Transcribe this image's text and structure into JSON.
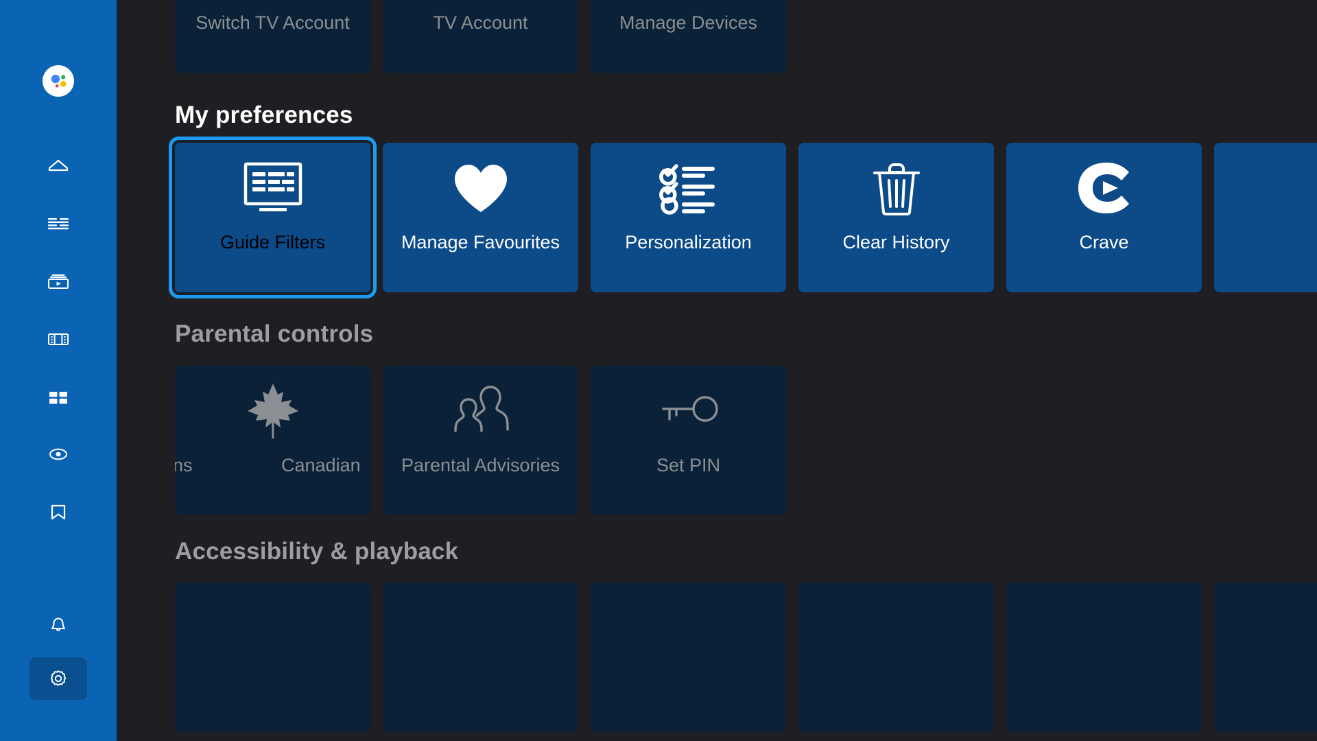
{
  "app": {
    "background_color": "#1f1f23",
    "sidebar_color": "#0b63b3",
    "card_inactive_color": "#0a2137",
    "card_accent_color": "#0c4a88",
    "focus_ring_color": "#1e9bf0"
  },
  "sidebar": {
    "assistant": {
      "name": "google-assistant-icon"
    },
    "items": [
      {
        "name": "home-icon",
        "label": "Home"
      },
      {
        "name": "guide-icon",
        "label": "Guide"
      },
      {
        "name": "on-demand-icon",
        "label": "On Demand"
      },
      {
        "name": "movies-icon",
        "label": "Movies"
      },
      {
        "name": "apps-icon",
        "label": "Apps"
      },
      {
        "name": "recordings-icon",
        "label": "Recordings"
      },
      {
        "name": "bookmarks-icon",
        "label": "Saved"
      }
    ],
    "bottom_items": [
      {
        "name": "notifications-bell-icon",
        "label": "Notifications",
        "active": false
      },
      {
        "name": "settings-gear-icon",
        "label": "Settings",
        "active": true
      }
    ]
  },
  "sections": [
    {
      "id": "account",
      "heading": "",
      "cards": [
        {
          "label": "Switch TV Account",
          "icon": "account-switch-icon",
          "state": "inactive"
        },
        {
          "label": "TV Account",
          "icon": "tv-account-icon",
          "state": "inactive"
        },
        {
          "label": "Manage Devices",
          "icon": "manage-devices-icon",
          "state": "inactive"
        }
      ]
    },
    {
      "id": "my-preferences",
      "heading": "My preferences",
      "cards": [
        {
          "label": "Guide Filters",
          "icon": "guide-filters-icon",
          "state": "focused"
        },
        {
          "label": "Manage Favourites",
          "icon": "heart-icon",
          "state": "accent"
        },
        {
          "label": "Personalization",
          "icon": "checklist-icon",
          "state": "accent"
        },
        {
          "label": "Clear History",
          "icon": "trash-icon",
          "state": "accent"
        },
        {
          "label": "Crave",
          "icon": "crave-logo-icon",
          "state": "accent"
        },
        {
          "label": "",
          "icon": "",
          "state": "accent"
        }
      ]
    },
    {
      "id": "parental-controls",
      "heading": "Parental controls",
      "cards": [
        {
          "label": "Canadian",
          "label_secondary": "cations",
          "icon": "maple-leaf-icon",
          "state": "inactive"
        },
        {
          "label": "Parental Advisories",
          "icon": "two-people-icon",
          "state": "inactive"
        },
        {
          "label": "Set PIN",
          "icon": "key-icon",
          "state": "inactive"
        }
      ]
    },
    {
      "id": "accessibility-playback",
      "heading": "Accessibility & playback",
      "cards": [
        {
          "label": "",
          "icon": "",
          "state": "inactive"
        },
        {
          "label": "",
          "icon": "",
          "state": "inactive"
        },
        {
          "label": "",
          "icon": "",
          "state": "inactive"
        },
        {
          "label": "",
          "icon": "",
          "state": "inactive"
        },
        {
          "label": "",
          "icon": "",
          "state": "inactive"
        },
        {
          "label": "",
          "icon": "",
          "state": "inactive"
        }
      ]
    }
  ]
}
